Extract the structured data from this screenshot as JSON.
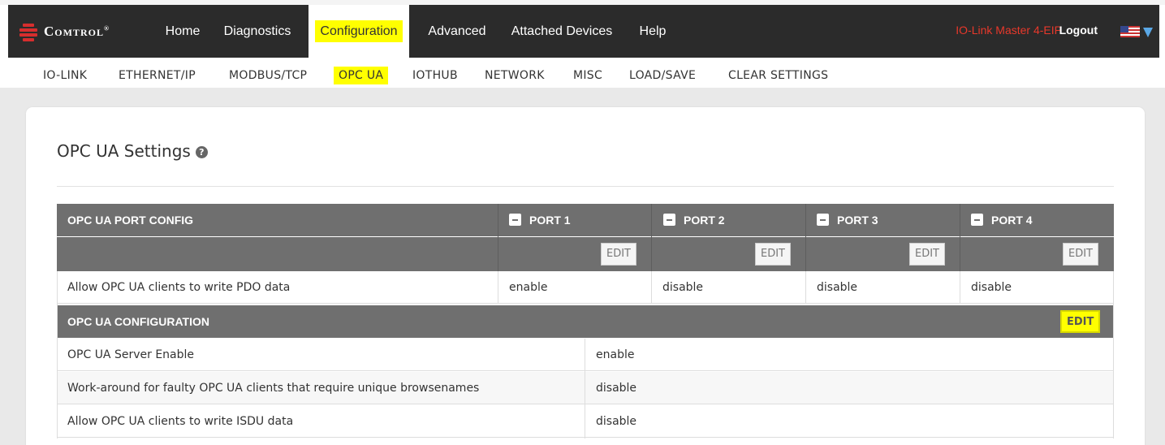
{
  "brand": {
    "name": "Comtrol",
    "reg_mark": "®"
  },
  "nav": {
    "items": [
      "Home",
      "Diagnostics",
      "Configuration",
      "Advanced",
      "Attached Devices",
      "Help"
    ],
    "device_name": "IO-Link Master 4-EIP",
    "logout": "Logout",
    "language_flag": "flag-us-icon"
  },
  "subnav": {
    "items": [
      "IO-LINK",
      "ETHERNET/IP",
      "MODBUS/TCP",
      "OPC UA",
      "IOTHUB",
      "NETWORK",
      "MISC",
      "LOAD/SAVE",
      "CLEAR SETTINGS"
    ]
  },
  "page": {
    "title": "OPC UA Settings",
    "help_icon": "?"
  },
  "port_config": {
    "title": "OPC UA PORT CONFIG",
    "ports": [
      "PORT 1",
      "PORT 2",
      "PORT 3",
      "PORT 4"
    ],
    "edit_label": "EDIT",
    "rows": [
      {
        "label": "Allow OPC UA clients to write PDO data",
        "values": [
          "enable",
          "disable",
          "disable",
          "disable"
        ]
      }
    ]
  },
  "configuration": {
    "title": "OPC UA CONFIGURATION",
    "edit_label": "EDIT",
    "rows": [
      {
        "label": "OPC UA Server Enable",
        "value": "enable"
      },
      {
        "label": "Work-around for faulty OPC UA clients that require unique browsenames",
        "value": "disable"
      },
      {
        "label": "Allow OPC UA clients to write ISDU data",
        "value": "disable"
      }
    ]
  },
  "colors": {
    "navbar": "#2b2b2b",
    "highlight": "#ffff00",
    "header": "#6f6f6f",
    "device_name": "#e8382b"
  }
}
